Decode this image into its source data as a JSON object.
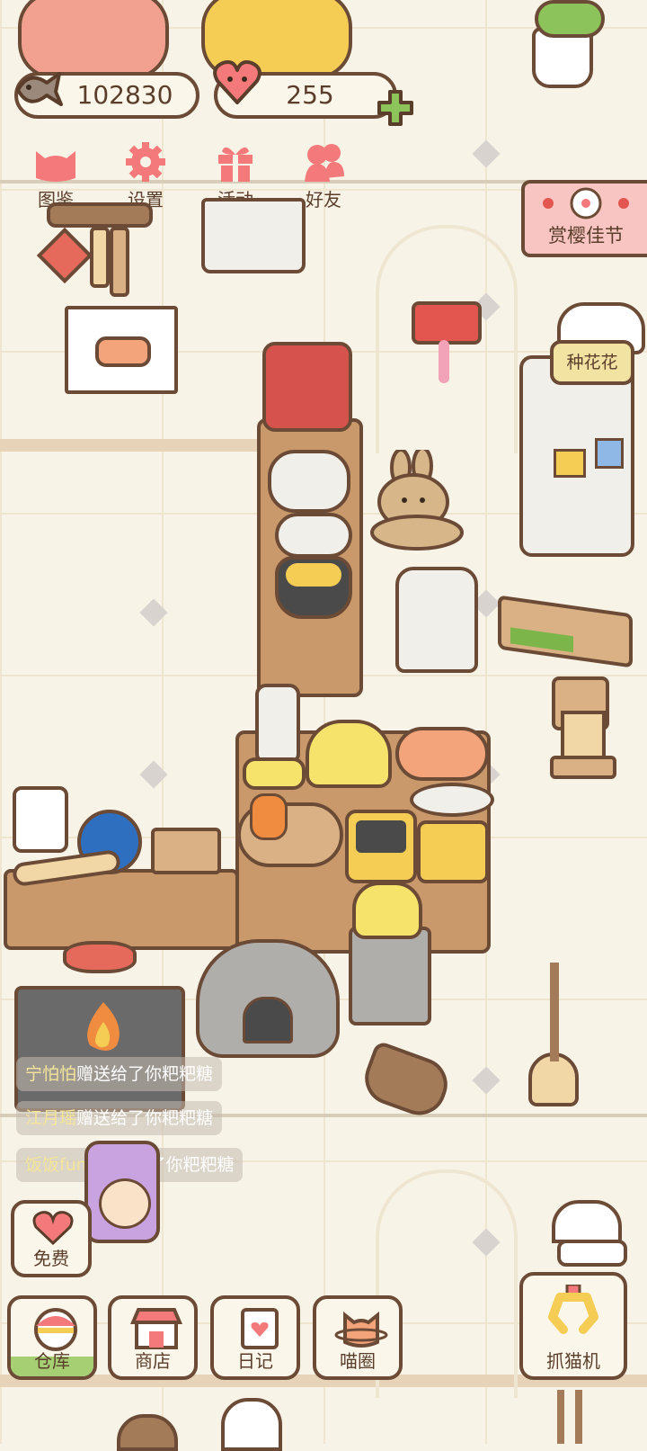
{
  "currency": {
    "fish": "102830",
    "hearts": "255",
    "add": "+"
  },
  "top_menu": {
    "catalog": "图鉴",
    "settings": "设置",
    "events": "活动",
    "friends": "好友"
  },
  "event_banner": "赏樱佳节",
  "npc_tag": "种花花",
  "chat": [
    {
      "name": "宁怕怕",
      "msg": "赠送给了你粑粑糖"
    },
    {
      "name": "江月瑶",
      "msg": "赠送给了你粑粑糖"
    },
    {
      "name": "饭饭fune",
      "msg": "赠送给了你粑粑糖"
    }
  ],
  "free_label": "免费",
  "bottom_menu": {
    "storage": "仓库",
    "shop": "商店",
    "diary": "日记",
    "circle": "喵圈",
    "claw": "抓猫机"
  },
  "colors": {
    "background": "#f8f3e7",
    "outline": "#6b4a36",
    "accent_pink": "#f4797a",
    "accent_green": "#8cc35a"
  }
}
